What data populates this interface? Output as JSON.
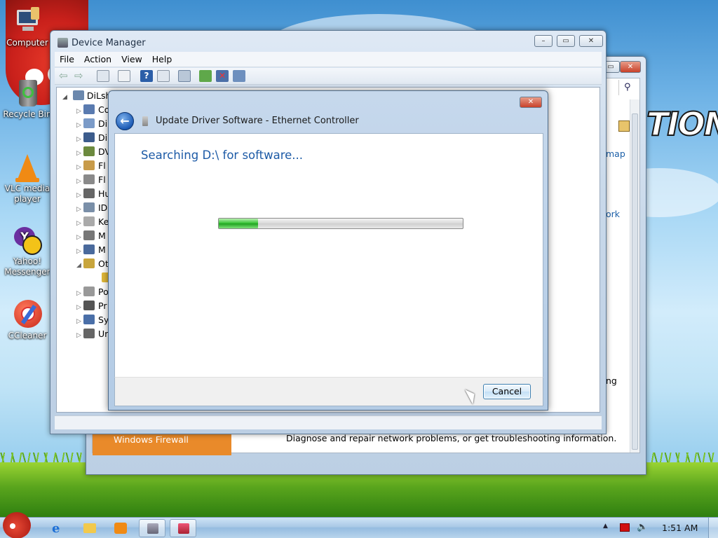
{
  "desktop": {
    "icons": [
      {
        "label": "Computer",
        "icon": "computer-icon"
      },
      {
        "label": "Recycle Bin",
        "icon": "recycle-bin-icon"
      },
      {
        "label": "VLC media player",
        "icon": "vlc-icon"
      },
      {
        "label": "Yahoo! Messenger",
        "icon": "yahoo-messenger-icon"
      },
      {
        "label": "CCleaner",
        "icon": "ccleaner-icon"
      }
    ],
    "wallpaper_text": "TION"
  },
  "control_panel": {
    "sidebar_links": [
      "map",
      "ork",
      "ng"
    ],
    "firewall_label": "Windows Firewall",
    "description": "Diagnose and repair network problems, or get troubleshooting information."
  },
  "device_manager": {
    "title": "Device Manager",
    "menu": [
      "File",
      "Action",
      "View",
      "Help"
    ],
    "root_label": "DiLsh",
    "tree_items": [
      "Co",
      "Di",
      "Di",
      "DV",
      "Fl",
      "Fl",
      "Hu",
      "ID",
      "Ke",
      "M",
      "M",
      "Ot",
      "",
      "Po",
      "Pr",
      "Sy",
      "Ur"
    ]
  },
  "dialog": {
    "title": "Update Driver Software - Ethernet Controller",
    "heading": "Searching D:\\ for software...",
    "progress": 0.16,
    "cancel_label": "Cancel"
  },
  "taskbar": {
    "clock": "1:51 AM",
    "tray_expand": "▲"
  },
  "colors": {
    "accent_blue": "#1b5fa8",
    "heading_blue": "#1c5aa6",
    "progress_green": "#2fbf2f",
    "close_red": "#c8412a"
  }
}
